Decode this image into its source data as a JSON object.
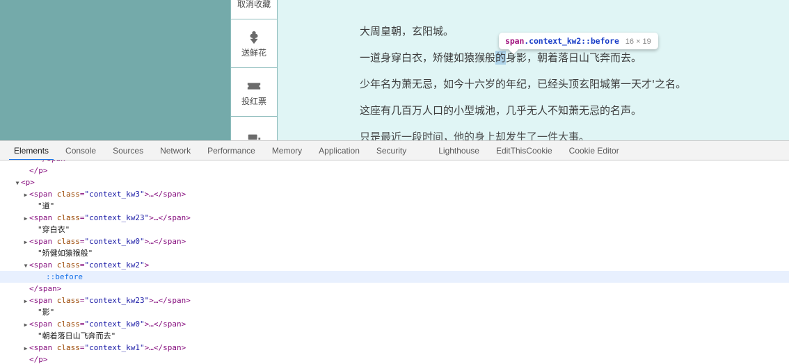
{
  "page": {
    "background_color": "#e0f5f5",
    "left_panel_color": "#74aaaa",
    "action_bar": {
      "items": [
        {
          "icon": "bookmark-filled-icon",
          "label": "取消收藏"
        },
        {
          "icon": "flower-icon",
          "label": "送鲜花"
        },
        {
          "icon": "ticket-star-icon",
          "label": "投红票"
        },
        {
          "icon": "partial-icon",
          "label": ""
        }
      ]
    },
    "article": {
      "lines": [
        {
          "id": "line-1",
          "segments": [
            {
              "text": "大周皇朝，玄阳城。",
              "highlight": false
            }
          ]
        },
        {
          "id": "line-2",
          "segments": [
            {
              "text": "一道身穿白衣，矫健如猿猴般",
              "highlight": false
            },
            {
              "text": "的",
              "highlight": true
            },
            {
              "text": "身影，朝着落日山飞奔而去。",
              "highlight": false
            }
          ]
        },
        {
          "id": "line-3",
          "segments": [
            {
              "text": "少年名为萧无忌，如今十六岁的年纪，已经头顶玄阳城第一天才'之名。",
              "highlight": false
            }
          ]
        },
        {
          "id": "line-4",
          "segments": [
            {
              "text": "这座有几百万人口的小型城池，几乎无人不知萧无忌的名声。",
              "highlight": false
            }
          ]
        },
        {
          "id": "line-5-clipped",
          "segments": [
            {
              "text": "只是最近一段时间，他的身上却发生了一件大事。",
              "highlight": false
            }
          ]
        }
      ]
    },
    "inspect_tooltip": {
      "tag": "span",
      "class_and_pseudo": ".context_kw2::before",
      "dimensions": "16 × 19"
    }
  },
  "devtools": {
    "tabs": [
      {
        "label": "Elements",
        "active": true,
        "gap": false
      },
      {
        "label": "Console",
        "active": false,
        "gap": false
      },
      {
        "label": "Sources",
        "active": false,
        "gap": false
      },
      {
        "label": "Network",
        "active": false,
        "gap": false
      },
      {
        "label": "Performance",
        "active": false,
        "gap": false
      },
      {
        "label": "Memory",
        "active": false,
        "gap": false
      },
      {
        "label": "Application",
        "active": false,
        "gap": false
      },
      {
        "label": "Security",
        "active": false,
        "gap": false
      },
      {
        "label": "Lighthouse",
        "active": false,
        "gap": true
      },
      {
        "label": "EditThisCookie",
        "active": false,
        "gap": false
      },
      {
        "label": "Cookie Editor",
        "active": false,
        "gap": false
      }
    ],
    "dom_rows": [
      {
        "indent": 3,
        "twisty": "",
        "selected": false,
        "clipped_top": true,
        "tokens": [
          {
            "t": "punct",
            "v": "</span>"
          }
        ]
      },
      {
        "indent": 2,
        "twisty": "",
        "selected": false,
        "tokens": [
          {
            "t": "punct",
            "v": "</p>"
          }
        ]
      },
      {
        "indent": 1,
        "twisty": "▼",
        "selected": false,
        "tokens": [
          {
            "t": "punct",
            "v": "<p>"
          }
        ]
      },
      {
        "indent": 2,
        "twisty": "▶",
        "selected": false,
        "tokens": [
          {
            "t": "punct",
            "v": "<"
          },
          {
            "t": "tag",
            "v": "span"
          },
          {
            "t": "sp",
            "v": " "
          },
          {
            "t": "attr",
            "v": "class"
          },
          {
            "t": "punct",
            "v": "="
          },
          {
            "t": "val",
            "v": "\"context_kw3\""
          },
          {
            "t": "punct",
            "v": ">"
          },
          {
            "t": "ellip",
            "v": "…"
          },
          {
            "t": "punct",
            "v": "</span>"
          }
        ]
      },
      {
        "indent": 3,
        "twisty": "",
        "selected": false,
        "tokens": [
          {
            "t": "text",
            "v": "\"道\""
          }
        ]
      },
      {
        "indent": 2,
        "twisty": "▶",
        "selected": false,
        "tokens": [
          {
            "t": "punct",
            "v": "<"
          },
          {
            "t": "tag",
            "v": "span"
          },
          {
            "t": "sp",
            "v": " "
          },
          {
            "t": "attr",
            "v": "class"
          },
          {
            "t": "punct",
            "v": "="
          },
          {
            "t": "val",
            "v": "\"context_kw23\""
          },
          {
            "t": "punct",
            "v": ">"
          },
          {
            "t": "ellip",
            "v": "…"
          },
          {
            "t": "punct",
            "v": "</span>"
          }
        ]
      },
      {
        "indent": 3,
        "twisty": "",
        "selected": false,
        "tokens": [
          {
            "t": "text",
            "v": "\"穿白衣\""
          }
        ]
      },
      {
        "indent": 2,
        "twisty": "▶",
        "selected": false,
        "tokens": [
          {
            "t": "punct",
            "v": "<"
          },
          {
            "t": "tag",
            "v": "span"
          },
          {
            "t": "sp",
            "v": " "
          },
          {
            "t": "attr",
            "v": "class"
          },
          {
            "t": "punct",
            "v": "="
          },
          {
            "t": "val",
            "v": "\"context_kw0\""
          },
          {
            "t": "punct",
            "v": ">"
          },
          {
            "t": "ellip",
            "v": "…"
          },
          {
            "t": "punct",
            "v": "</span>"
          }
        ]
      },
      {
        "indent": 3,
        "twisty": "",
        "selected": false,
        "tokens": [
          {
            "t": "text",
            "v": "\"矫健如猿猴般\""
          }
        ]
      },
      {
        "indent": 2,
        "twisty": "▼",
        "selected": false,
        "tokens": [
          {
            "t": "punct",
            "v": "<"
          },
          {
            "t": "tag",
            "v": "span"
          },
          {
            "t": "sp",
            "v": " "
          },
          {
            "t": "attr",
            "v": "class"
          },
          {
            "t": "punct",
            "v": "="
          },
          {
            "t": "val",
            "v": "\"context_kw2\""
          },
          {
            "t": "punct",
            "v": ">"
          }
        ]
      },
      {
        "indent": 4,
        "twisty": "",
        "selected": true,
        "tokens": [
          {
            "t": "pseudo",
            "v": "::before"
          }
        ]
      },
      {
        "indent": 2,
        "twisty": "",
        "selected": false,
        "tokens": [
          {
            "t": "punct",
            "v": "</span>"
          }
        ]
      },
      {
        "indent": 2,
        "twisty": "▶",
        "selected": false,
        "tokens": [
          {
            "t": "punct",
            "v": "<"
          },
          {
            "t": "tag",
            "v": "span"
          },
          {
            "t": "sp",
            "v": " "
          },
          {
            "t": "attr",
            "v": "class"
          },
          {
            "t": "punct",
            "v": "="
          },
          {
            "t": "val",
            "v": "\"context_kw23\""
          },
          {
            "t": "punct",
            "v": ">"
          },
          {
            "t": "ellip",
            "v": "…"
          },
          {
            "t": "punct",
            "v": "</span>"
          }
        ]
      },
      {
        "indent": 3,
        "twisty": "",
        "selected": false,
        "tokens": [
          {
            "t": "text",
            "v": "\"影\""
          }
        ]
      },
      {
        "indent": 2,
        "twisty": "▶",
        "selected": false,
        "tokens": [
          {
            "t": "punct",
            "v": "<"
          },
          {
            "t": "tag",
            "v": "span"
          },
          {
            "t": "sp",
            "v": " "
          },
          {
            "t": "attr",
            "v": "class"
          },
          {
            "t": "punct",
            "v": "="
          },
          {
            "t": "val",
            "v": "\"context_kw0\""
          },
          {
            "t": "punct",
            "v": ">"
          },
          {
            "t": "ellip",
            "v": "…"
          },
          {
            "t": "punct",
            "v": "</span>"
          }
        ]
      },
      {
        "indent": 3,
        "twisty": "",
        "selected": false,
        "tokens": [
          {
            "t": "text",
            "v": "\"朝着落日山飞奔而去\""
          }
        ]
      },
      {
        "indent": 2,
        "twisty": "▶",
        "selected": false,
        "tokens": [
          {
            "t": "punct",
            "v": "<"
          },
          {
            "t": "tag",
            "v": "span"
          },
          {
            "t": "sp",
            "v": " "
          },
          {
            "t": "attr",
            "v": "class"
          },
          {
            "t": "punct",
            "v": "="
          },
          {
            "t": "val",
            "v": "\"context_kw1\""
          },
          {
            "t": "punct",
            "v": ">"
          },
          {
            "t": "ellip",
            "v": "…"
          },
          {
            "t": "punct",
            "v": "</span>"
          }
        ]
      },
      {
        "indent": 2,
        "twisty": "",
        "selected": false,
        "clipped_bottom": true,
        "tokens": [
          {
            "t": "punct",
            "v": "</p>"
          }
        ]
      }
    ]
  }
}
